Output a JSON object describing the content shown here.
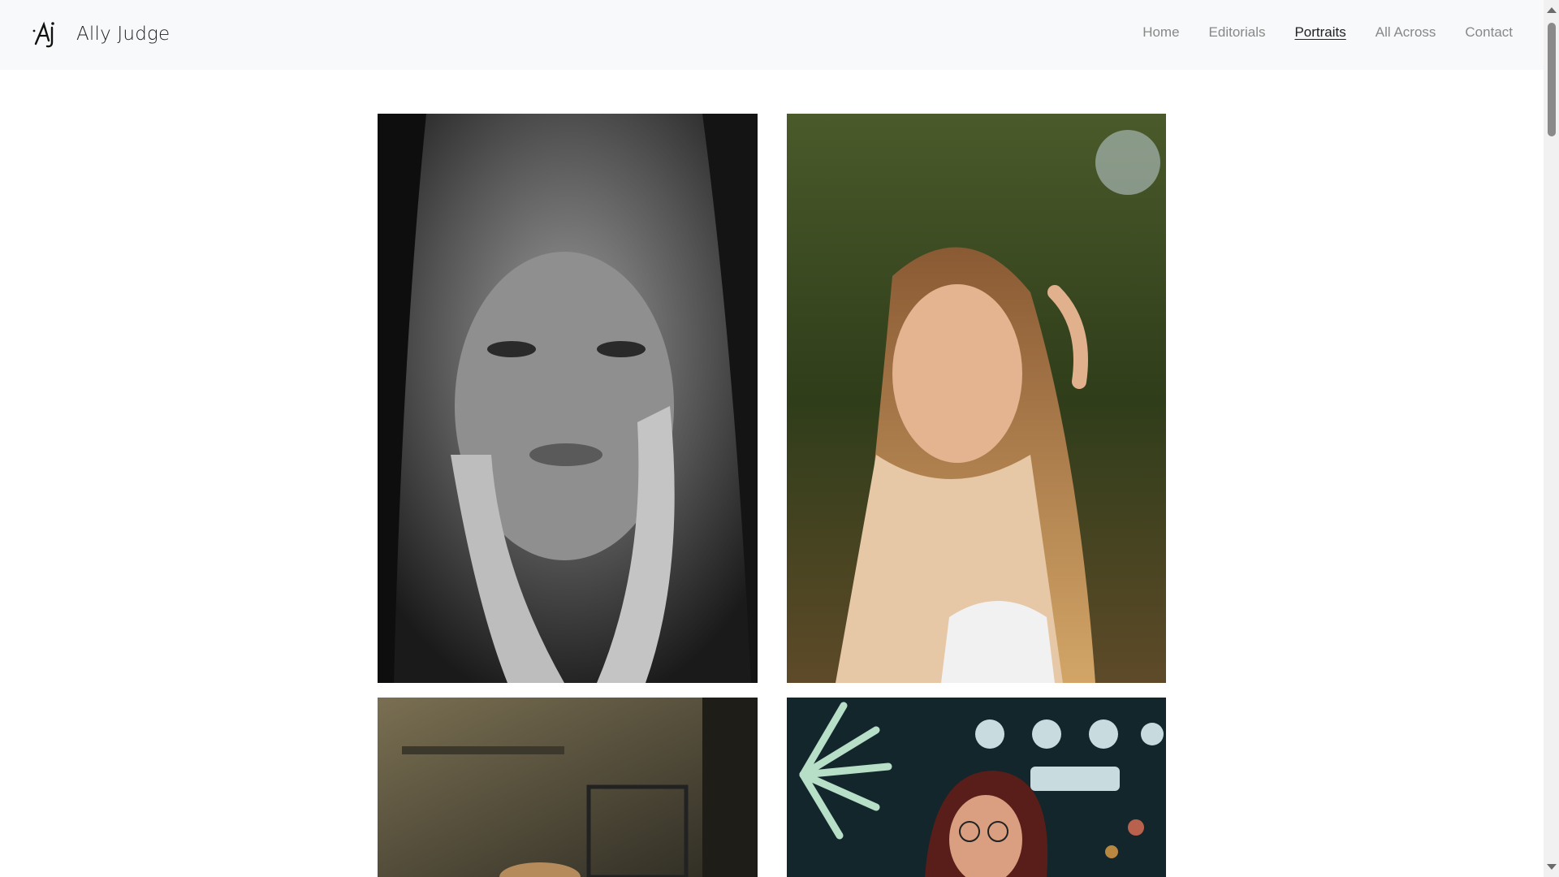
{
  "header": {
    "brand_name": "Ally Judge",
    "logo_icon": "aj-monogram-logo-icon"
  },
  "nav": [
    {
      "label": "Home",
      "active": false
    },
    {
      "label": "Editorials",
      "active": false
    },
    {
      "label": "Portraits",
      "active": true
    },
    {
      "label": "All Across",
      "active": false
    },
    {
      "label": "Contact",
      "active": false
    }
  ],
  "gallery": {
    "photos": [
      {
        "subject": "black-and-white portrait, woman with freckles, hands on cheeks"
      },
      {
        "subject": "woman with long blonde hair outdoors, trees background"
      },
      {
        "subject": "portrait indoors, warm tones (partially visible)"
      },
      {
        "subject": "woman with glasses at night fair, ferris wheel lights (partially visible)"
      }
    ]
  },
  "colors": {
    "header_bg": "#f8f9fa",
    "nav_text": "#888888",
    "nav_active": "#222222",
    "page_bg": "#ffffff"
  }
}
